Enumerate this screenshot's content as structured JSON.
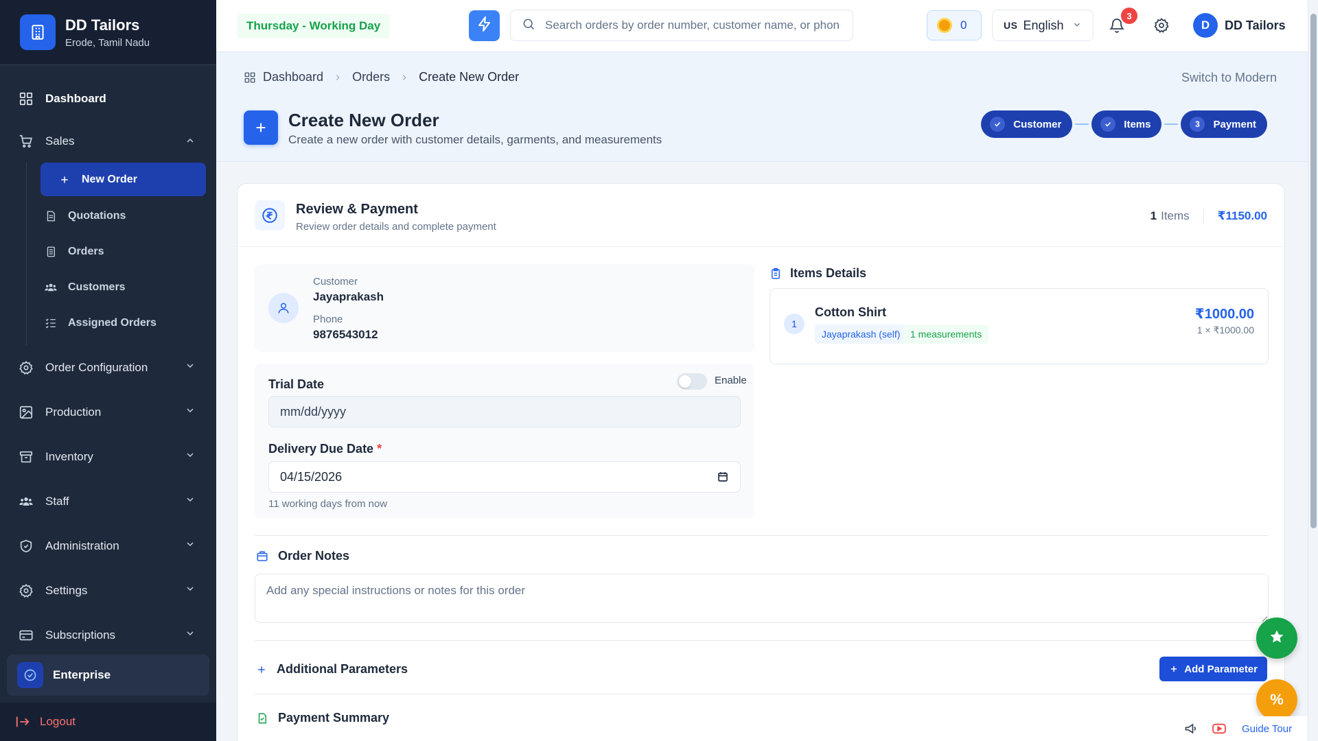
{
  "brand": {
    "title": "DD Tailors",
    "location": "Erode, Tamil Nadu"
  },
  "sidebar": {
    "dashboard": "Dashboard",
    "sales": "Sales",
    "sales_items": [
      "New Order",
      "Quotations",
      "Orders",
      "Customers",
      "Assigned Orders"
    ],
    "sections": [
      "Order Configuration",
      "Production",
      "Inventory",
      "Staff",
      "Administration",
      "Settings",
      "Subscriptions"
    ],
    "plan": "Enterprise",
    "logout": "Logout"
  },
  "topbar": {
    "day_status": "Thursday - Working Day",
    "search_placeholder": "Search orders by order number, customer name, or phone",
    "coins": "0",
    "language_code": "US",
    "language": "English",
    "notifications": "3",
    "user_initial": "D",
    "user_name": "DD Tailors"
  },
  "breadcrumb": [
    "Dashboard",
    "Orders",
    "Create New Order"
  ],
  "switch_label": "Switch to Modern",
  "page": {
    "title": "Create New Order",
    "subtitle": "Create a new order with customer details, garments, and measurements"
  },
  "steps": [
    {
      "label": "Customer",
      "state": "done"
    },
    {
      "label": "Items",
      "state": "done"
    },
    {
      "label": "Payment",
      "number": "3",
      "state": "current"
    }
  ],
  "review": {
    "title": "Review & Payment",
    "subtitle": "Review order details and complete payment",
    "item_count": "1",
    "items_word": "Items",
    "total": "₹1150.00"
  },
  "customer": {
    "label": "Customer",
    "name": "Jayaprakash",
    "phone_label": "Phone",
    "phone": "9876543012"
  },
  "trial": {
    "label": "Trial Date",
    "toggle_label": "Enable",
    "enabled": false,
    "placeholder": "mm/dd/yyyy"
  },
  "delivery": {
    "label": "Delivery Due Date",
    "required_mark": "*",
    "value": "04/15/2026",
    "hint": "11 working days from now"
  },
  "items_details": {
    "title": "Items Details",
    "items": [
      {
        "index": "1",
        "name": "Cotton Shirt",
        "person_tag": "Jayaprakash (self)",
        "measure_tag": "1 measurements",
        "price": "₹1000.00",
        "qty_line": "1 × ₹1000.00"
      }
    ]
  },
  "notes": {
    "title": "Order Notes",
    "placeholder": "Add any special instructions or notes for this order"
  },
  "params": {
    "title": "Additional Parameters",
    "button": "Add Parameter"
  },
  "payment": {
    "title": "Payment Summary"
  },
  "fab": {
    "discount_symbol": "%"
  },
  "guide": "Guide Tour",
  "colors": {
    "primary": "#2563eb",
    "sidebar": "#1e293b",
    "success": "#16a34a",
    "danger": "#ef4444",
    "warning": "#f59e0b"
  }
}
